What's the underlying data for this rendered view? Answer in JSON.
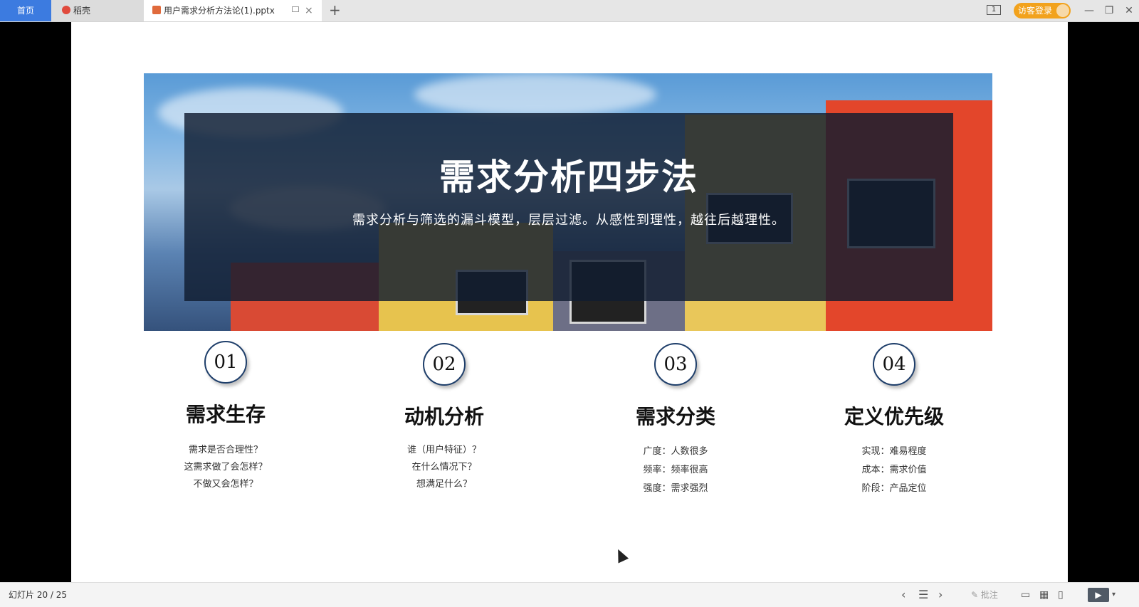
{
  "tabs": {
    "home": "首页",
    "daoke": "稻壳",
    "document": "用户需求分析方法论(1).pptx",
    "close_symbol": "×",
    "new_symbol": "+"
  },
  "topbar": {
    "page_count_icon": "1",
    "login_label": "访客登录",
    "minimize_symbol": "—",
    "restore_symbol": "❐",
    "close_symbol": "✕"
  },
  "slide": {
    "title": "需求分析四步法",
    "subtitle": "需求分析与筛选的漏斗模型，层层过滤。从感性到理性，越往后越理性。",
    "steps": [
      {
        "number": "01",
        "title": "需求生存",
        "lines": [
          "需求是否合理性？",
          "这需求做了会怎样？",
          "不做又会怎样？"
        ]
      },
      {
        "number": "02",
        "title": "动机分析",
        "lines": [
          "谁（用户特征）？",
          "在什么情况下？",
          "想满足什么？"
        ]
      },
      {
        "number": "03",
        "title": "需求分类",
        "lines": [
          "广度：人数很多",
          "频率：频率很高",
          "强度：需求强烈"
        ]
      },
      {
        "number": "04",
        "title": "定义优先级",
        "lines": [
          "实现：难易程度",
          "成本：需求价值",
          "阶段：产品定位"
        ]
      }
    ]
  },
  "statusbar": {
    "slide_counter": "幻灯片 20 / 25",
    "comment_label": "批注",
    "prev_symbol": "‹",
    "outline_symbol": "☰",
    "next_symbol": "›",
    "play_symbol": "▶",
    "dropdown_symbol": "▾"
  },
  "colors": {
    "tab_active": "#3c7be0",
    "login_orange": "#f2a21c",
    "overlay": "#101c30",
    "circle_border": "#1f3f6b"
  }
}
